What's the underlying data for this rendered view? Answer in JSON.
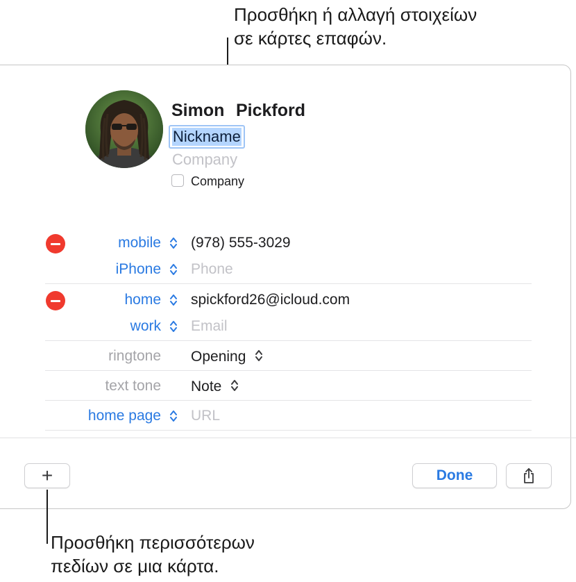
{
  "callouts": {
    "top": [
      "Προσθήκη ή αλλαγή στοιχείων",
      "σε κάρτες επαφών."
    ],
    "bottom": [
      "Προσθήκη περισσότερων",
      "πεδίων σε μια κάρτα."
    ]
  },
  "contact": {
    "first_name": "Simon",
    "last_name": "Pickford",
    "nickname": "Nickname",
    "company_placeholder": "Company",
    "company_checkbox_label": "Company",
    "company_checked": false
  },
  "phones": [
    {
      "label": "mobile",
      "value": "(978) 555-3029"
    },
    {
      "label": "iPhone",
      "placeholder": "Phone"
    }
  ],
  "emails": [
    {
      "label": "home",
      "value": "spickford26@icloud.com"
    },
    {
      "label": "work",
      "placeholder": "Email"
    }
  ],
  "ringtone": {
    "label": "ringtone",
    "value": "Opening"
  },
  "text_tone": {
    "label": "text tone",
    "value": "Note"
  },
  "url": {
    "label": "home page",
    "placeholder": "URL"
  },
  "footer": {
    "add_label": "+",
    "done_label": "Done"
  },
  "colors": {
    "accent": "#2a7ae2",
    "delete": "#f03a2e",
    "selection": "#b4d5fe"
  }
}
